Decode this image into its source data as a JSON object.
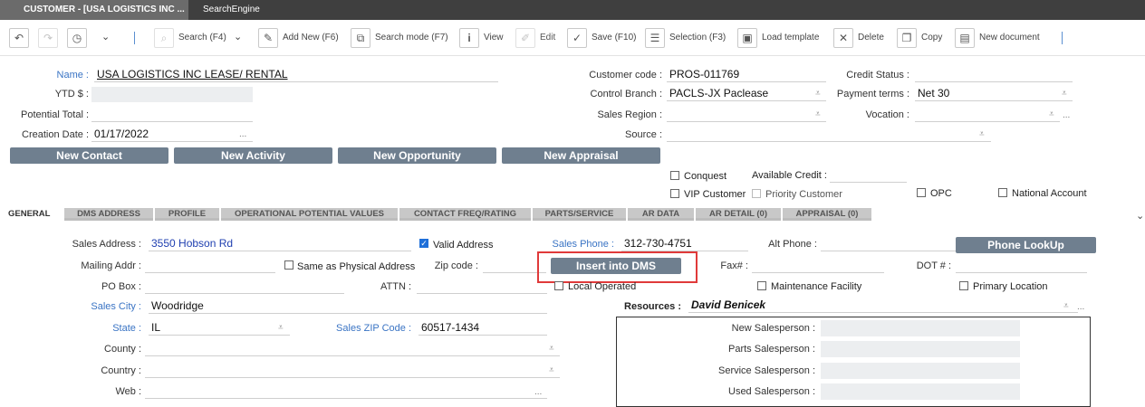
{
  "window_tabs": [
    {
      "label": "CUSTOMER - [USA LOGISTICS INC ..."
    },
    {
      "label": "SearchEngine"
    }
  ],
  "toolbar": {
    "search": "Search (F4)",
    "add_new": "Add New (F6)",
    "search_mode": "Search mode (F7)",
    "view": "View",
    "edit": "Edit",
    "save": "Save (F10)",
    "selection": "Selection (F3)",
    "load_template": "Load template",
    "delete": "Delete",
    "copy": "Copy",
    "new_document": "New document"
  },
  "header": {
    "name_label": "Name :",
    "name_value": "USA LOGISTICS INC  LEASE/ RENTAL",
    "ytd_label": "YTD $ :",
    "potential_label": "Potential Total :",
    "creation_label": "Creation Date :",
    "creation_value": "01/17/2022",
    "customer_code_label": "Customer code :",
    "customer_code_value": "PROS-011769",
    "control_branch_label": "Control Branch :",
    "control_branch_value": "PACLS-JX Paclease",
    "sales_region_label": "Sales Region :",
    "source_label": "Source :",
    "credit_status_label": "Credit Status :",
    "payment_terms_label": "Payment terms :",
    "payment_terms_value": "Net 30",
    "vocation_label": "Vocation :",
    "ellipsis": "..."
  },
  "action_buttons": {
    "new_contact": "New Contact",
    "new_activity": "New Activity",
    "new_opportunity": "New Opportunity",
    "new_appraisal": "New Appraisal"
  },
  "flags": {
    "conquest": "Conquest",
    "available_credit": "Available Credit :",
    "vip_customer": "VIP Customer",
    "priority_customer": "Priority Customer",
    "opc": "OPC",
    "national_account": "National Account"
  },
  "section_tabs": [
    "GENERAL",
    "DMS ADDRESS",
    "PROFILE",
    "OPERATIONAL POTENTIAL VALUES",
    "CONTACT FREQ/RATING",
    "PARTS/SERVICE",
    "AR DATA",
    "AR DETAIL (0)",
    "APPRAISAL (0)"
  ],
  "general": {
    "sales_address_label": "Sales Address :",
    "sales_address_value": "3550 Hobson Rd",
    "valid_address": "Valid Address",
    "sales_phone_label": "Sales Phone :",
    "sales_phone_value": "312-730-4751",
    "alt_phone_label": "Alt Phone :",
    "phone_lookup": "Phone LookUp",
    "mailing_label": "Mailing Addr :",
    "same_as_physical": "Same as Physical Address",
    "zip_label": "Zip code :",
    "insert_dms": "Insert into DMS",
    "fax_label": "Fax# :",
    "dot_label": "DOT # :",
    "po_box_label": "PO Box :",
    "attn_label": "ATTN :",
    "local_operated": "Local Operated",
    "maintenance_facility": "Maintenance Facility",
    "primary_location": "Primary Location",
    "sales_city_label": "Sales City :",
    "sales_city_value": "Woodridge",
    "resources_label": "Resources :",
    "resources_value": "David Benicek",
    "state_label": "State :",
    "state_value": "IL",
    "sales_zip_label": "Sales ZIP Code :",
    "sales_zip_value": "60517-1434",
    "county_label": "County :",
    "country_label": "Country :",
    "web_label": "Web :",
    "new_salesperson": "New Salesperson :",
    "parts_salesperson": "Parts Salesperson :",
    "service_salesperson": "Service Salesperson :",
    "used_salesperson": "Used Salesperson :"
  }
}
